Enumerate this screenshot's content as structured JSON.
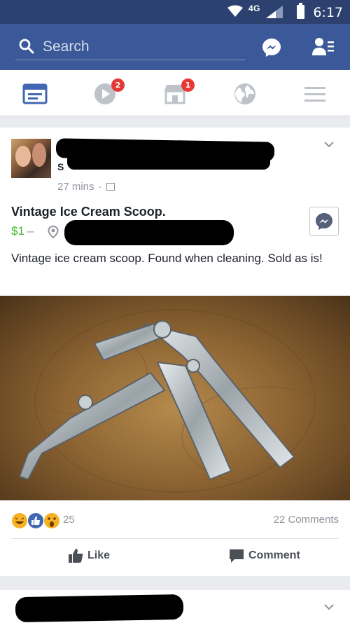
{
  "status_bar": {
    "network": "4G",
    "time": "6:17"
  },
  "app_bar": {
    "search_placeholder": "Search"
  },
  "tabs": [
    {
      "name": "news-feed",
      "badge": ""
    },
    {
      "name": "video",
      "badge": "2"
    },
    {
      "name": "marketplace",
      "badge": "1"
    },
    {
      "name": "notifications",
      "badge": ""
    },
    {
      "name": "menu",
      "badge": ""
    }
  ],
  "post": {
    "poster_fragment": "S",
    "time": "27 mins",
    "title": "Vintage Ice Cream Scoop.",
    "price": "$1",
    "price_separator": "–",
    "description": "Vintage ice cream scoop. Found when cleaning. Sold as is!",
    "reaction_count": "25",
    "comment_count": "22 Comments",
    "like_label": "Like",
    "comment_label": "Comment"
  },
  "colors": {
    "brand": "#3b5998",
    "status_bar": "#2c4170",
    "price": "#42b72a",
    "badge": "#e53935"
  }
}
